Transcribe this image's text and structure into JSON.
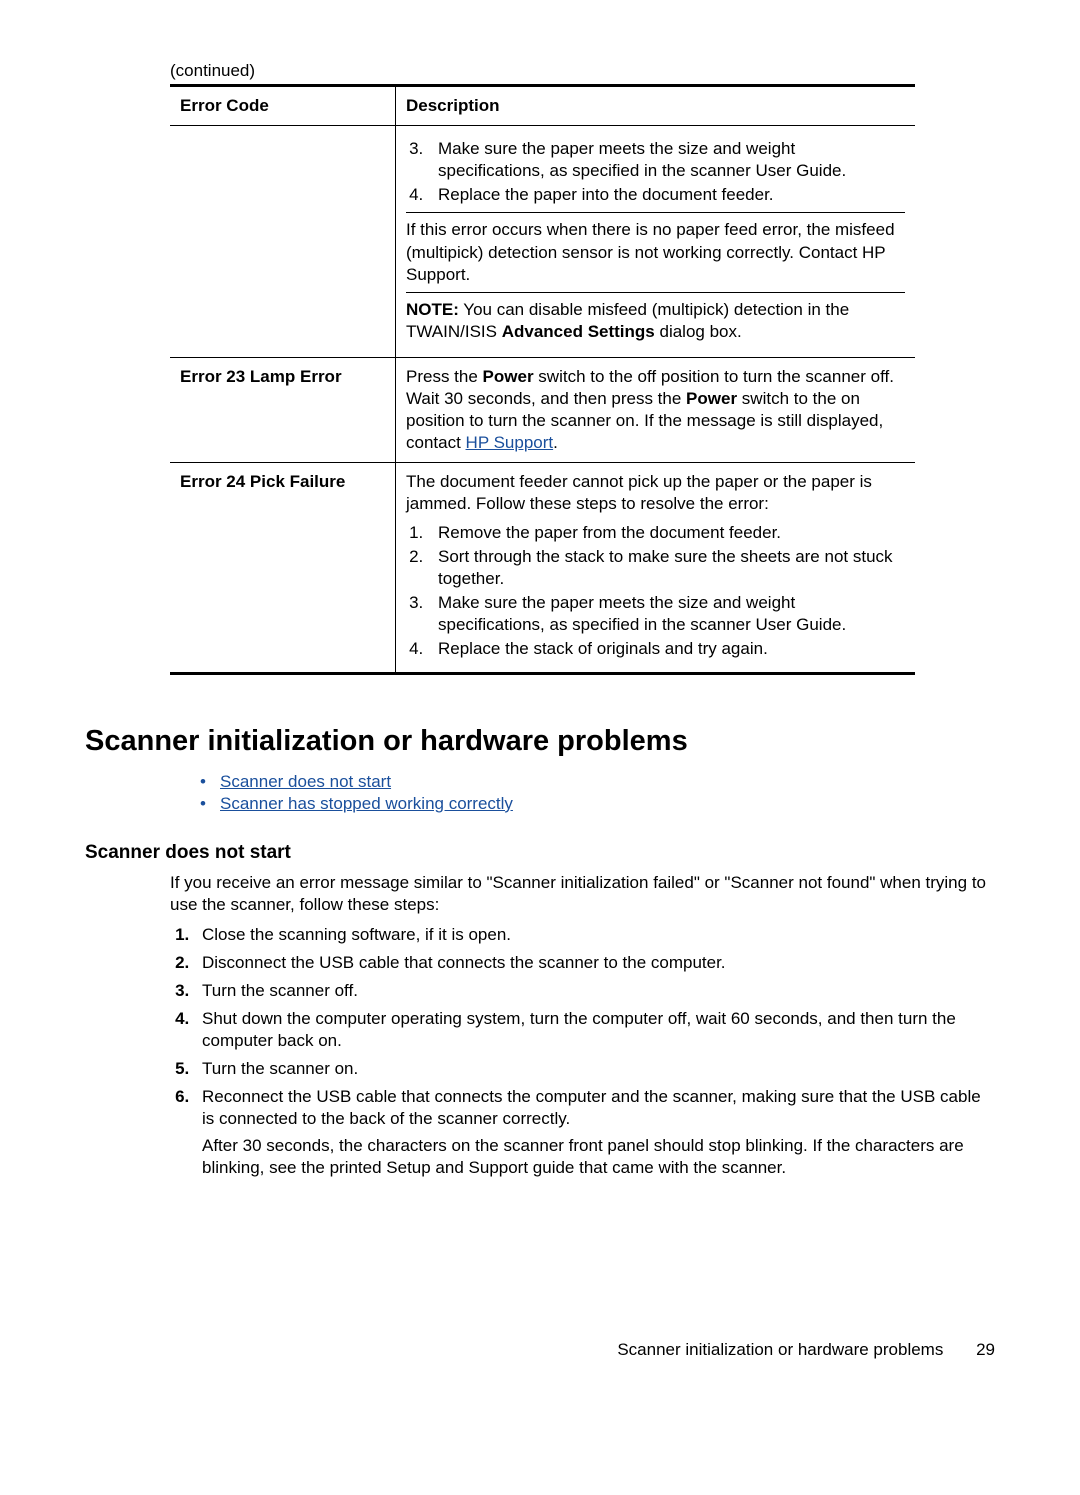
{
  "continued": "(continued)",
  "table": {
    "headers": {
      "code": "Error Code",
      "desc": "Description"
    },
    "row1": {
      "ol3": "Make sure the paper meets the size and weight specifications, as specified in the scanner User Guide.",
      "ol4": "Replace the paper into the document feeder.",
      "p1": "If this error occurs when there is no paper feed error, the misfeed (multipick) detection sensor is not working correctly. Contact HP Support.",
      "note_label": "NOTE:",
      "note_a": "   You can disable misfeed (multipick) detection in the TWAIN/ISIS ",
      "note_b": "Advanced Settings",
      "note_c": " dialog box."
    },
    "row2": {
      "code": "Error 23 Lamp Error",
      "d_a": "Press the ",
      "d_b": "Power",
      "d_c": " switch to the off position to turn the scanner off. Wait 30 seconds, and then press the ",
      "d_d": "Power",
      "d_e": " switch to the on position to turn the scanner on. If the message is still displayed, contact ",
      "d_link": "HP Support",
      "d_f": "."
    },
    "row3": {
      "code": "Error 24 Pick Failure",
      "p1": "The document feeder cannot pick up the paper or the paper is jammed. Follow these steps to resolve the error:",
      "ol1": "Remove the paper from the document feeder.",
      "ol2": "Sort through the stack to make sure the sheets are not stuck together.",
      "ol3": "Make sure the paper meets the size and weight specifications, as specified in the scanner User Guide.",
      "ol4": "Replace the stack of originals and try again."
    }
  },
  "h1": "Scanner initialization or hardware problems",
  "links": {
    "l1": "Scanner does not start",
    "l2": "Scanner has stopped working correctly"
  },
  "sub": "Scanner does not start",
  "intro": "If you receive an error message similar to \"Scanner initialization failed\" or \"Scanner not found\" when trying to use the scanner, follow these steps:",
  "steps": {
    "s1": "Close the scanning software, if it is open.",
    "s2": "Disconnect the USB cable that connects the scanner to the computer.",
    "s3": "Turn the scanner off.",
    "s4": "Shut down the computer operating system, turn the computer off, wait 60 seconds, and then turn the computer back on.",
    "s5": "Turn the scanner on.",
    "s6a": "Reconnect the USB cable that connects the computer and the scanner, making sure that the USB cable is connected to the back of the scanner correctly.",
    "s6b": "After 30 seconds, the characters on the scanner front panel should stop blinking. If the characters are blinking, see the printed Setup and Support guide that came with the scanner."
  },
  "footer": {
    "text": "Scanner initialization or hardware problems",
    "page": "29"
  }
}
